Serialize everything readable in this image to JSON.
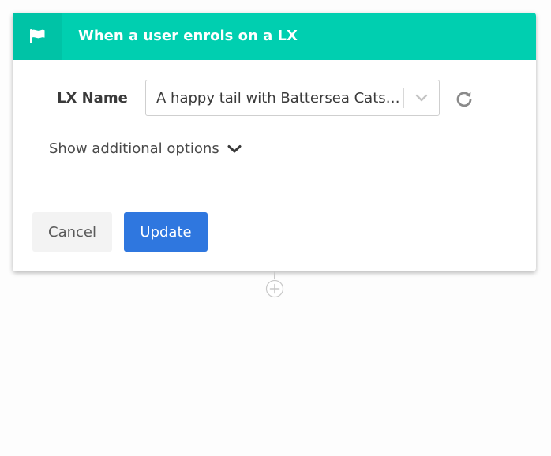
{
  "trigger_card": {
    "title": "When a user enrols on a LX",
    "header_color": "#00cfb0",
    "icon": "flag-icon"
  },
  "lx_field": {
    "label": "LX Name",
    "selected_value": "A happy tail with Battersea Cats and Dogs Home",
    "chevron_icon": "chevron-down-icon",
    "refresh_icon": "refresh-icon"
  },
  "options_toggle": {
    "label": "Show additional options",
    "icon": "chevron-down-icon"
  },
  "actions": {
    "cancel_label": "Cancel",
    "update_label": "Update",
    "update_color": "#2f77df"
  },
  "flow": {
    "add_step_icon": "plus-circle-icon"
  }
}
